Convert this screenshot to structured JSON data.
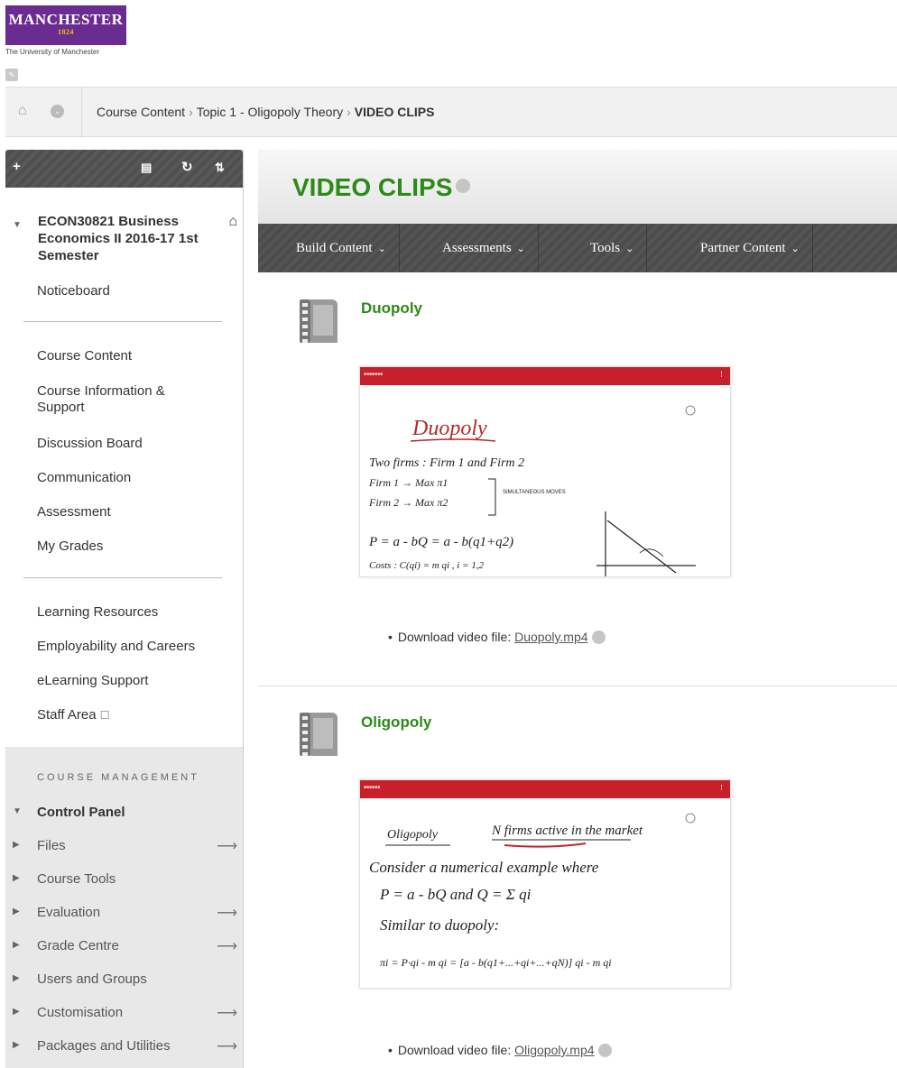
{
  "logo": {
    "name": "MANCHESTER",
    "year": "1824",
    "subtitle": "The University of Manchester"
  },
  "breadcrumb": {
    "items": [
      "Course Content",
      "Topic 1 - Oligopoly Theory"
    ],
    "current": "VIDEO CLIPS",
    "separator": "›"
  },
  "sidebar": {
    "course_title": "ECON30821 Business Economics II 2016-17 1st Semester",
    "noticeboard": "Noticeboard",
    "group1": [
      "Course Content",
      "Course Information & Support",
      "Discussion Board",
      "Communication",
      "Assessment",
      "My Grades"
    ],
    "group2": [
      "Learning Resources",
      "Employability and Careers",
      "eLearning Support",
      "Staff Area"
    ],
    "management_title": "COURSE MANAGEMENT",
    "control_panel": "Control Panel",
    "control_items": [
      "Files",
      "Course Tools",
      "Evaluation",
      "Grade Centre",
      "Users and Groups",
      "Customisation",
      "Packages and Utilities"
    ]
  },
  "page": {
    "title": "VIDEO CLIPS",
    "actions": [
      "Build Content",
      "Assessments",
      "Tools",
      "Partner Content"
    ]
  },
  "items": [
    {
      "title": "Duopoly",
      "download_label": "Download video file:",
      "file": "Duopoly.mp4"
    },
    {
      "title": "Oligopoly",
      "download_label": "Download video file:",
      "file": "Oligopoly.mp4"
    }
  ],
  "video_notes": {
    "duopoly": [
      "Duopoly",
      "Two firms : Firm 1 and Firm 2",
      "Firm 1 → Max π1",
      "Firm 2 → Max π2",
      "SIMULTANEOUS MOVES",
      "P = a - bQ = a - b(q1+q2)",
      "Costs : C(qi) = m qi , i = 1,2"
    ],
    "oligopoly": [
      "Oligopoly",
      "N firms active in the market",
      "Consider a numerical example where",
      "P = a - bQ and Q = Σ qi",
      "Similar to duopoly:",
      "πi = P·qi - m qi = [a - b(q1+...+qi+...+qN)] qi - m qi"
    ]
  },
  "colors": {
    "brand": "#6b2c91",
    "accent_green": "#2c8a17",
    "video_bar": "#c8202a"
  }
}
